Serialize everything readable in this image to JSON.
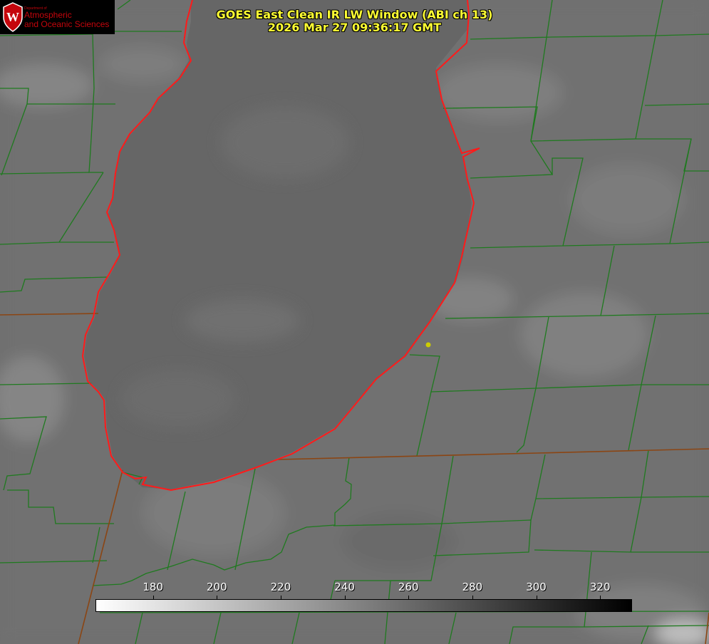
{
  "header": {
    "title": "GOES East Clean IR LW Window (ABI ch 13)",
    "timestamp": "2026 Mar 27 09:36:17 GMT"
  },
  "logo": {
    "department": "Department of",
    "line1": "Atmospheric",
    "line2": "and Oceanic Sciences",
    "icon": "crest-icon"
  },
  "colorbar": {
    "min": 162,
    "max": 330,
    "ticks": [
      {
        "label": "180",
        "value": 180
      },
      {
        "label": "200",
        "value": 200
      },
      {
        "label": "220",
        "value": 220
      },
      {
        "label": "240",
        "value": 240
      },
      {
        "label": "260",
        "value": 260
      },
      {
        "label": "280",
        "value": 280
      },
      {
        "label": "300",
        "value": 300
      },
      {
        "label": "320",
        "value": 320
      }
    ]
  },
  "colors": {
    "title": "#ffff33",
    "county_lines": "#1f7a1f",
    "state_lines": "#8b4513",
    "shoreline": "#ff1a1a",
    "marker": "#cccc00"
  }
}
